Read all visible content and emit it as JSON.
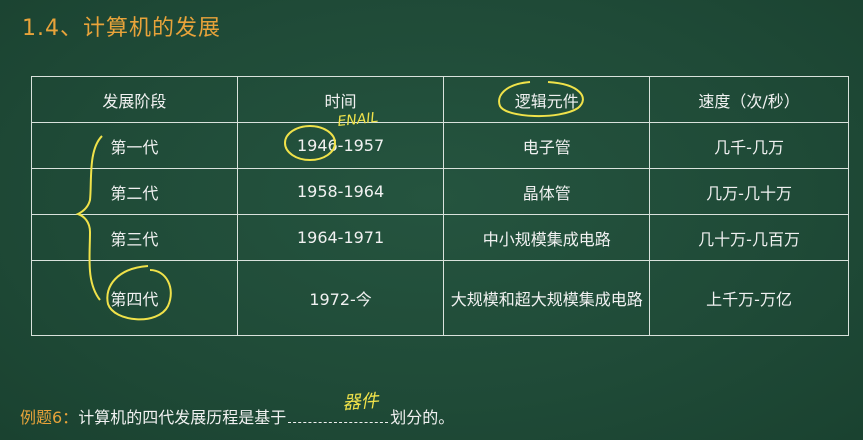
{
  "title": "1.4、计算机的发展",
  "table": {
    "headers": [
      "发展阶段",
      "时间",
      "逻辑元件",
      "速度（次/秒）"
    ],
    "rows": [
      [
        "第一代",
        "1946-1957",
        "电子管",
        "几千-几万"
      ],
      [
        "第二代",
        "1958-1964",
        "晶体管",
        "几万-几十万"
      ],
      [
        "第三代",
        "1964-1971",
        "中小规模集成电路",
        "几十万-几百万"
      ],
      [
        "第四代",
        "1972-今",
        "大规模和超大规模集成电路",
        "上千万-万亿"
      ]
    ]
  },
  "annotations": {
    "eniac_note": "ENAIL",
    "blank_answer": "器件"
  },
  "example": {
    "label": "例题6：",
    "text_before": "计算机的四代发展历程是基于",
    "text_after": "划分的。"
  },
  "colors": {
    "board": "#1e4a36",
    "title": "#e8a33a",
    "chalk": "#f1f1f1",
    "highlighter": "#f0e24a"
  }
}
